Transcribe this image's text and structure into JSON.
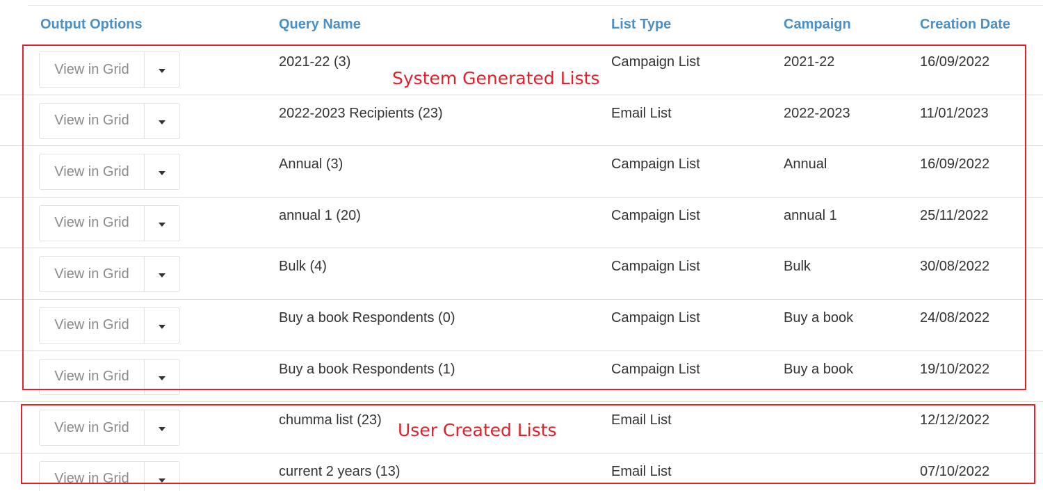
{
  "table": {
    "headers": {
      "output_options": "Output Options",
      "query_name": "Query Name",
      "list_type": "List Type",
      "campaign": "Campaign",
      "creation_date": "Creation Date"
    },
    "view_button_label": "View in Grid",
    "rows": [
      {
        "query_name": "2021-22 (3)",
        "list_type": "Campaign List",
        "campaign": "2021-22",
        "creation_date": "16/09/2022",
        "view_label": "View in Grid"
      },
      {
        "query_name": "2022-2023 Recipients (23)",
        "list_type": "Email List",
        "campaign": "2022-2023",
        "creation_date": "11/01/2023",
        "view_label": "View in Grid"
      },
      {
        "query_name": "Annual (3)",
        "list_type": "Campaign List",
        "campaign": "Annual",
        "creation_date": "16/09/2022",
        "view_label": "View in Grid"
      },
      {
        "query_name": "annual 1 (20)",
        "list_type": "Campaign List",
        "campaign": "annual 1",
        "creation_date": "25/11/2022",
        "view_label": "View in Grid"
      },
      {
        "query_name": "Bulk (4)",
        "list_type": "Campaign List",
        "campaign": "Bulk",
        "creation_date": "30/08/2022",
        "view_label": "View in Grid"
      },
      {
        "query_name": "Buy a book Respondents (0)",
        "list_type": "Campaign List",
        "campaign": "Buy a book",
        "creation_date": "24/08/2022",
        "view_label": "View in Grid"
      },
      {
        "query_name": "Buy a book Respondents (1)",
        "list_type": "Campaign List",
        "campaign": "Buy a book",
        "creation_date": "19/10/2022",
        "view_label": "View in Grid"
      },
      {
        "query_name": "chumma list (23)",
        "list_type": "Email List",
        "campaign": "",
        "creation_date": "12/12/2022",
        "view_label": "View in Grid"
      },
      {
        "query_name": "current 2 years (13)",
        "list_type": "Email List",
        "campaign": "",
        "creation_date": "07/10/2022",
        "view_label": "View in Grid"
      }
    ]
  },
  "annotations": {
    "system_label": "System Generated Lists",
    "user_label": "User Created Lists",
    "color": "#e0202a"
  },
  "colors": {
    "header_text": "#4a8fc7",
    "body_text": "#333333",
    "button_text": "#8a8a8a"
  },
  "icons": {
    "dropdown": "caret-down-icon"
  }
}
